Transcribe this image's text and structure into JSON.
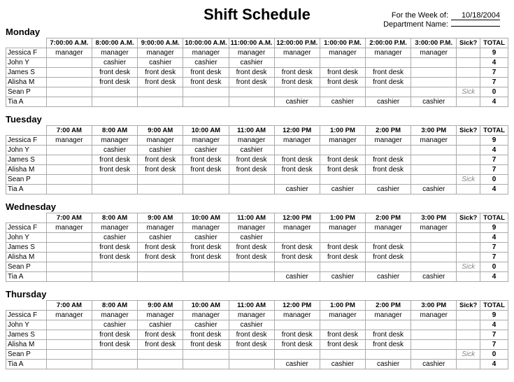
{
  "title": "Shift Schedule",
  "header": {
    "week_label": "For the Week of:",
    "week_value": "10/18/2004",
    "dept_label": "Department Name:",
    "dept_value": ""
  },
  "days": [
    {
      "name": "Monday",
      "times": [
        "7:00:00 A.M.",
        "8:00:00 A.M.",
        "9:00:00 A.M.",
        "10:00:00 A.M.",
        "11:00:00 A.M.",
        "12:00:00 P.M.",
        "1:00:00 P.M.",
        "2:00:00 P.M.",
        "3:00:00 P.M."
      ],
      "employees": [
        {
          "name": "Jessica F",
          "shifts": [
            "manager",
            "manager",
            "manager",
            "manager",
            "manager",
            "manager",
            "manager",
            "manager",
            "manager"
          ],
          "sick": "",
          "total": "9"
        },
        {
          "name": "John Y",
          "shifts": [
            "",
            "cashier",
            "cashier",
            "cashier",
            "cashier",
            "",
            "",
            "",
            ""
          ],
          "sick": "",
          "total": "4"
        },
        {
          "name": "James S",
          "shifts": [
            "",
            "front desk",
            "front desk",
            "front desk",
            "front desk",
            "front desk",
            "front desk",
            "front desk",
            ""
          ],
          "sick": "",
          "total": "7"
        },
        {
          "name": "Alisha M",
          "shifts": [
            "",
            "front desk",
            "front desk",
            "front desk",
            "front desk",
            "front desk",
            "front desk",
            "front desk",
            ""
          ],
          "sick": "",
          "total": "7"
        },
        {
          "name": "Sean P",
          "shifts": [
            "",
            "",
            "",
            "",
            "",
            "",
            "",
            "",
            ""
          ],
          "sick": "Sick",
          "total": "0"
        },
        {
          "name": "Tia A",
          "shifts": [
            "",
            "",
            "",
            "",
            "",
            "cashier",
            "cashier",
            "cashier",
            "cashier"
          ],
          "sick": "",
          "total": "4"
        }
      ]
    },
    {
      "name": "Tuesday",
      "times": [
        "7:00 AM",
        "8:00 AM",
        "9:00 AM",
        "10:00 AM",
        "11:00 AM",
        "12:00 PM",
        "1:00 PM",
        "2:00 PM",
        "3:00 PM"
      ],
      "employees": [
        {
          "name": "Jessica F",
          "shifts": [
            "manager",
            "manager",
            "manager",
            "manager",
            "manager",
            "manager",
            "manager",
            "manager",
            "manager"
          ],
          "sick": "",
          "total": "9"
        },
        {
          "name": "John Y",
          "shifts": [
            "",
            "cashier",
            "cashier",
            "cashier",
            "cashier",
            "",
            "",
            "",
            ""
          ],
          "sick": "",
          "total": "4"
        },
        {
          "name": "James S",
          "shifts": [
            "",
            "front desk",
            "front desk",
            "front desk",
            "front desk",
            "front desk",
            "front desk",
            "front desk",
            ""
          ],
          "sick": "",
          "total": "7"
        },
        {
          "name": "Alisha M",
          "shifts": [
            "",
            "front desk",
            "front desk",
            "front desk",
            "front desk",
            "front desk",
            "front desk",
            "front desk",
            ""
          ],
          "sick": "",
          "total": "7"
        },
        {
          "name": "Sean P",
          "shifts": [
            "",
            "",
            "",
            "",
            "",
            "",
            "",
            "",
            ""
          ],
          "sick": "Sick",
          "total": "0"
        },
        {
          "name": "Tia A",
          "shifts": [
            "",
            "",
            "",
            "",
            "",
            "cashier",
            "cashier",
            "cashier",
            "cashier"
          ],
          "sick": "",
          "total": "4"
        }
      ]
    },
    {
      "name": "Wednesday",
      "times": [
        "7:00 AM",
        "8:00 AM",
        "9:00 AM",
        "10:00 AM",
        "11:00 AM",
        "12:00 PM",
        "1:00 PM",
        "2:00 PM",
        "3:00 PM"
      ],
      "employees": [
        {
          "name": "Jessica F",
          "shifts": [
            "manager",
            "manager",
            "manager",
            "manager",
            "manager",
            "manager",
            "manager",
            "manager",
            "manager"
          ],
          "sick": "",
          "total": "9"
        },
        {
          "name": "John Y",
          "shifts": [
            "",
            "cashier",
            "cashier",
            "cashier",
            "cashier",
            "",
            "",
            "",
            ""
          ],
          "sick": "",
          "total": "4"
        },
        {
          "name": "James S",
          "shifts": [
            "",
            "front desk",
            "front desk",
            "front desk",
            "front desk",
            "front desk",
            "front desk",
            "front desk",
            ""
          ],
          "sick": "",
          "total": "7"
        },
        {
          "name": "Alisha M",
          "shifts": [
            "",
            "front desk",
            "front desk",
            "front desk",
            "front desk",
            "front desk",
            "front desk",
            "front desk",
            ""
          ],
          "sick": "",
          "total": "7"
        },
        {
          "name": "Sean P",
          "shifts": [
            "",
            "",
            "",
            "",
            "",
            "",
            "",
            "",
            ""
          ],
          "sick": "Sick",
          "total": "0"
        },
        {
          "name": "Tia A",
          "shifts": [
            "",
            "",
            "",
            "",
            "",
            "cashier",
            "cashier",
            "cashier",
            "cashier"
          ],
          "sick": "",
          "total": "4"
        }
      ]
    },
    {
      "name": "Thursday",
      "times": [
        "7:00 AM",
        "8:00 AM",
        "9:00 AM",
        "10:00 AM",
        "11:00 AM",
        "12:00 PM",
        "1:00 PM",
        "2:00 PM",
        "3:00 PM"
      ],
      "employees": [
        {
          "name": "Jessica F",
          "shifts": [
            "manager",
            "manager",
            "manager",
            "manager",
            "manager",
            "manager",
            "manager",
            "manager",
            "manager"
          ],
          "sick": "",
          "total": "9"
        },
        {
          "name": "John Y",
          "shifts": [
            "",
            "cashier",
            "cashier",
            "cashier",
            "cashier",
            "",
            "",
            "",
            ""
          ],
          "sick": "",
          "total": "4"
        },
        {
          "name": "James S",
          "shifts": [
            "",
            "front desk",
            "front desk",
            "front desk",
            "front desk",
            "front desk",
            "front desk",
            "front desk",
            ""
          ],
          "sick": "",
          "total": "7"
        },
        {
          "name": "Alisha M",
          "shifts": [
            "",
            "front desk",
            "front desk",
            "front desk",
            "front desk",
            "front desk",
            "front desk",
            "front desk",
            ""
          ],
          "sick": "",
          "total": "7"
        },
        {
          "name": "Sean P",
          "shifts": [
            "",
            "",
            "",
            "",
            "",
            "",
            "",
            "",
            ""
          ],
          "sick": "Sick",
          "total": "0"
        },
        {
          "name": "Tia A",
          "shifts": [
            "",
            "",
            "",
            "",
            "",
            "cashier",
            "cashier",
            "cashier",
            "cashier"
          ],
          "sick": "",
          "total": "4"
        }
      ]
    }
  ],
  "col_headers": {
    "name": "",
    "sick": "Sick?",
    "total": "TOTAL"
  }
}
